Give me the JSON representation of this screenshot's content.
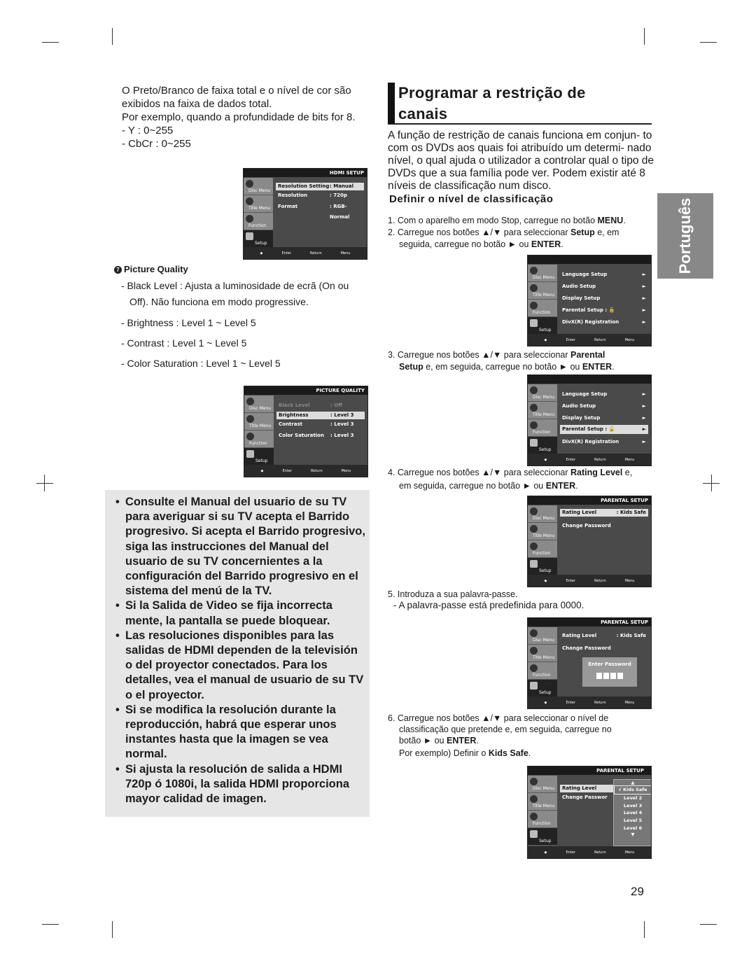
{
  "left_column": {
    "intro_lines": [
      "O Preto/Branco de faixa total e o nível de cor são",
      "exibidos na faixa de dados total.",
      "Por exemplo, quando a profundidade de bits for 8.",
      "- Y : 0~255",
      "- CbCr : 0~255"
    ],
    "picture_quality": {
      "number": "7",
      "title": "Picture Quality",
      "lines": [
        "- Black Level : Ajusta a luminosidade de ecrã (On ou",
        "Off). Não funciona em modo progressive.",
        "- Brightness : Level 1 ~ Level 5",
        "- Contrast : Level 1 ~ Level 5",
        "- Color Saturation : Level 1 ~ Level 5"
      ]
    },
    "notes": [
      "Consulte el Manual del usuario de su TV para averiguar si su TV acepta el Barrido progresivo. Si acepta el Barrido progresivo, siga las instrucciones del Manual del usuario de su TV concernientes a la configuración del Barrido progresivo en el sistema del menú de la TV.",
      "Si la Salida de Video se fija   incorrecta mente, la pantalla se puede bloquear.",
      "Las resoluciones disponibles para las salidas de HDMI dependen de la televisión o del proyector conectados. Para los detalles, vea el manual de usuario de su TV o el  proyector.",
      "Si se modifica la resolución durante la reproducción, habrá que esperar unos instantes hasta que la imagen se vea normal.",
      "Si ajusta la resolución de salida a HDMI 720p ó 1080i, la salida HDMI proporciona mayor calidad de imagen."
    ]
  },
  "menu_common": {
    "side": [
      "Disc Menu",
      "Title Menu",
      "Function",
      "Setup"
    ],
    "bottom": [
      "Enter",
      "Return",
      "Menu"
    ]
  },
  "screens": {
    "hdmi": {
      "title": "HDMI SETUP",
      "rows": [
        {
          "label": "Resolution Setting",
          "value": ": Manual"
        },
        {
          "label": "Resolution",
          "value": ": 720p"
        },
        {
          "label": "Format",
          "value": ": RGB-Normal"
        }
      ]
    },
    "picture": {
      "title": "PICTURE QUALITY",
      "rows": [
        {
          "label": "Black Level",
          "value": ": Off"
        },
        {
          "label": "Brightness",
          "value": ": Level 3"
        },
        {
          "label": "Contrast",
          "value": ": Level 3"
        },
        {
          "label": "Color Saturation",
          "value": ": Level 3"
        }
      ]
    },
    "setup": {
      "title": "",
      "rows": [
        {
          "label": "Language Setup",
          "value": "►"
        },
        {
          "label": "Audio Setup",
          "value": "►"
        },
        {
          "label": "Display Setup",
          "value": "►"
        },
        {
          "label": "Parental Setup :",
          "value": "►"
        },
        {
          "label": "DivX(R) Registration",
          "value": "►"
        }
      ]
    },
    "parental": {
      "title": "PARENTAL SETUP",
      "rows": [
        {
          "label": "Rating Level",
          "value": ": Kids Safe"
        },
        {
          "label": "Change Password",
          "value": ""
        }
      ],
      "password_prompt": "Enter Password",
      "dropdown": [
        "√ Kids Safe",
        "Level 2",
        "Level 3",
        "Level 4",
        "Level 5",
        "Level 6"
      ],
      "change_password_truncated": "Change Passwor"
    }
  },
  "right_column": {
    "title_line1": "Programar a restrição de",
    "title_line2": "canais",
    "lead": "A função de restrição de canais funciona em conjun- to com os DVDs aos quais foi atribuído um determi- nado nível, o qual ajuda o utilizador a controlar qual o tipo de DVDs que a sua família pode ver. Podem existir até 8 níveis de classificação num disco.",
    "subtitle": "Definir o nível de classificação",
    "steps": {
      "s1": [
        "1. Com o aparelho em modo Stop, carregue no botão ",
        "MENU",
        "."
      ],
      "s2a": [
        "2. Carregue nos botões ▲/▼ para seleccionar ",
        "Setup",
        " e, em"
      ],
      "s2b": [
        "seguida, carregue no botão ► ou ",
        "ENTER",
        "."
      ],
      "s3a": [
        "3. Carregue nos botões ▲/▼ para seleccionar ",
        "Parental"
      ],
      "s3b": [
        "Setup",
        " e, em seguida, carregue no botão ► ou ",
        "ENTER",
        "."
      ],
      "s4a": [
        "4. Carregue nos botões ▲/▼ para seleccionar ",
        "Rating Level",
        " e,"
      ],
      "s4b": [
        "em seguida, carregue no botão ► ou ",
        "ENTER",
        "."
      ],
      "s5a": "5. Introduza a sua palavra-passe.",
      "s5b": "- A palavra-passe está predefinida para 0000.",
      "s6a": "6. Carregue nos botões ▲/▼ para seleccionar o nível  de",
      "s6b": "classificação que pretende e, em seguida,  carregue no",
      "s6c": [
        "botão ► ou ",
        "ENTER",
        "."
      ],
      "s6d": [
        "Por exemplo) Definir o ",
        "Kids Safe",
        "."
      ]
    }
  },
  "language_tab": "Português",
  "page_number": "29"
}
